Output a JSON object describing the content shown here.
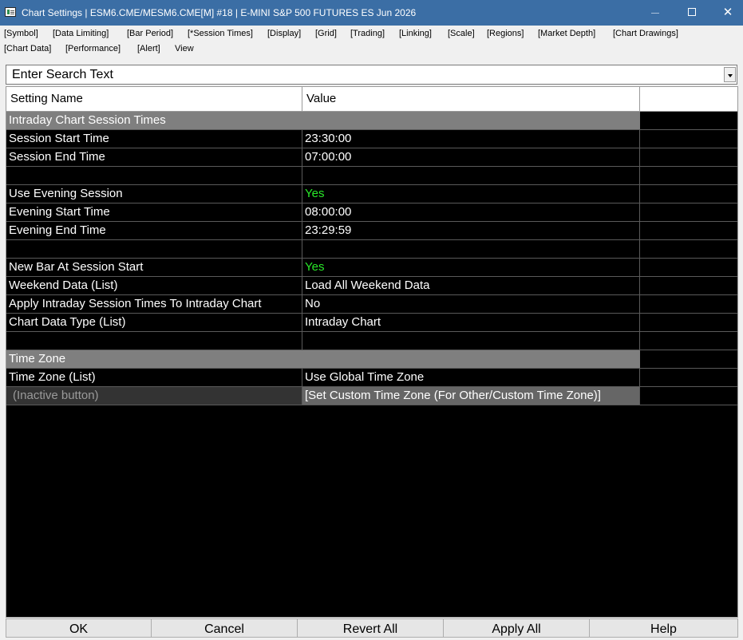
{
  "window": {
    "title": "Chart Settings | ESM6.CME/MESM6.CME[M] #18 | E-MINI S&P 500 FUTURES ES Jun 2026",
    "close_glyph": "✕"
  },
  "menu": {
    "row1": [
      "[Symbol]",
      "[Data Limiting]",
      "[Bar Period]",
      "[*Session Times]",
      "[Display]",
      "[Grid]",
      "[Trading]",
      "[Linking]",
      "[Scale]",
      "[Regions]",
      "[Market Depth]",
      "[Chart Drawings]"
    ],
    "row2": [
      "[Chart Data]",
      "[Performance]",
      "[Alert]",
      "View"
    ]
  },
  "search": {
    "text": "Enter Search Text"
  },
  "table": {
    "headers": {
      "name": "Setting Name",
      "value": "Value"
    },
    "rows": [
      {
        "type": "section",
        "name": "Intraday Chart Session Times"
      },
      {
        "type": "row",
        "name": "Session Start Time",
        "value": "23:30:00"
      },
      {
        "type": "row",
        "name": "Session End Time",
        "value": "07:00:00"
      },
      {
        "type": "blank"
      },
      {
        "type": "row",
        "name": "Use Evening Session",
        "value": "Yes",
        "accent": "green"
      },
      {
        "type": "row",
        "name": "Evening Start Time",
        "value": "08:00:00"
      },
      {
        "type": "row",
        "name": "Evening End Time",
        "value": "23:29:59"
      },
      {
        "type": "blank"
      },
      {
        "type": "row",
        "name": "New Bar At Session Start",
        "value": "Yes",
        "accent": "green"
      },
      {
        "type": "row",
        "name": "Weekend Data (List)",
        "value": "Load All Weekend Data"
      },
      {
        "type": "row",
        "name": "Apply Intraday Session Times To Intraday Chart",
        "value": "No"
      },
      {
        "type": "row",
        "name": "Chart Data Type (List)",
        "value": "Intraday Chart"
      },
      {
        "type": "blank"
      },
      {
        "type": "section",
        "name": "Time Zone"
      },
      {
        "type": "row",
        "name": "Time Zone (List)",
        "value": "Use Global Time Zone"
      },
      {
        "type": "inactive",
        "name": "(Inactive button)",
        "value": "[Set Custom Time Zone (For Other/Custom Time Zone)]"
      }
    ]
  },
  "footer": {
    "buttons": [
      "OK",
      "Cancel",
      "Revert All",
      "Apply All",
      "Help"
    ]
  },
  "colors": {
    "titlebar": "#3b6ea5",
    "grid_background": "#000000",
    "section_background": "#7f7f7f",
    "yes_value": "#29e829"
  }
}
